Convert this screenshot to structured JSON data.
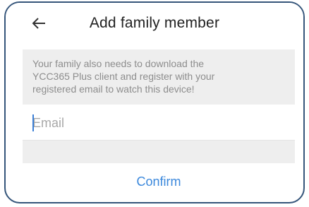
{
  "header": {
    "title": "Add family member",
    "back_icon": "arrow-left-icon"
  },
  "notice": {
    "lines": [
      "Your family also needs to download the",
      "YCC365 Plus client and register with your",
      "registered email to watch this device!"
    ]
  },
  "email": {
    "placeholder": "Email",
    "value": ""
  },
  "confirm": {
    "label": "Confirm"
  },
  "colors": {
    "accent": "#3b88dc",
    "frame_border": "#35557a",
    "notice_bg": "#eeeeee",
    "notice_text": "#8d8d8d"
  }
}
